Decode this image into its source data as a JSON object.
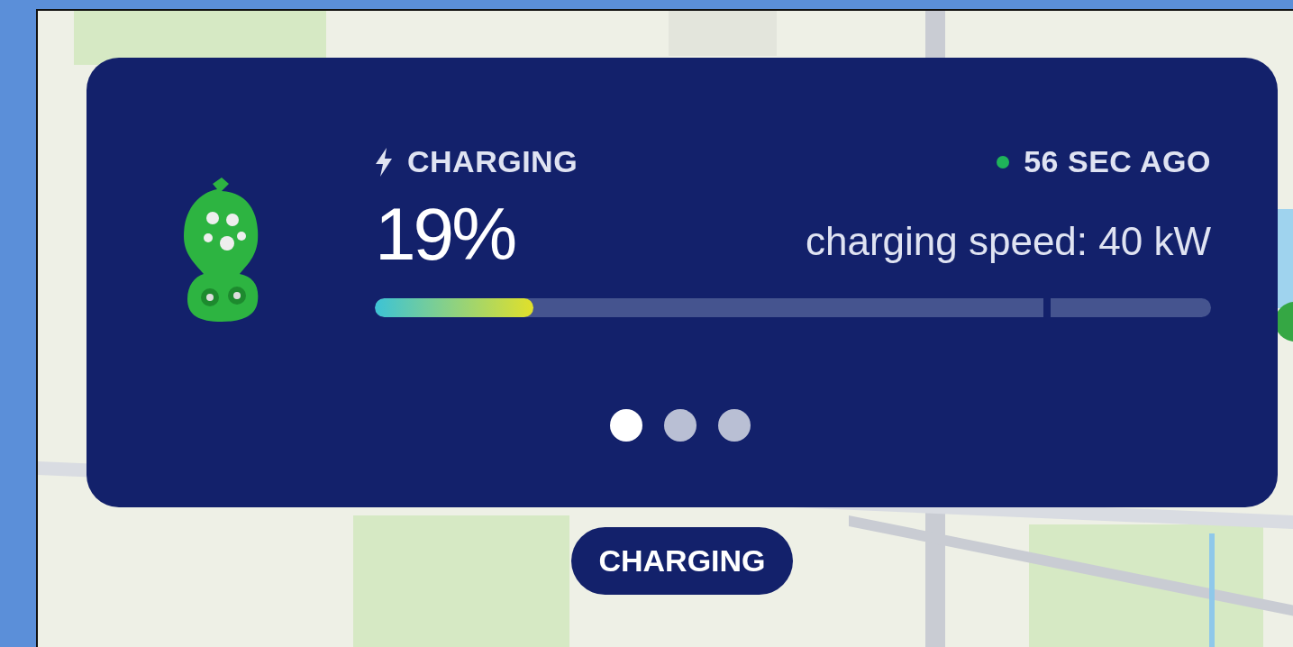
{
  "status": {
    "label": "CHARGING",
    "updated": "56 SEC AGO",
    "color": "#1fb35a"
  },
  "battery": {
    "percent": "19%",
    "speed": "charging speed: 40 kW",
    "level": 0.19
  },
  "pages": [
    {
      "selected": true
    },
    {
      "selected": false
    },
    {
      "selected": false
    }
  ],
  "map_label": "CHARGING"
}
